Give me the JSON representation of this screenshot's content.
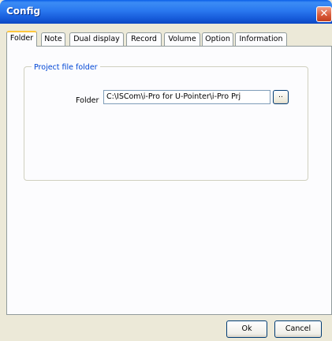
{
  "window": {
    "title": "Config",
    "close_glyph": "✕"
  },
  "tabs": [
    {
      "label": "Folder",
      "active": true
    },
    {
      "label": "Note"
    },
    {
      "label": "Dual display"
    },
    {
      "label": "Record"
    },
    {
      "label": "Volume"
    },
    {
      "label": "Option"
    },
    {
      "label": "Information"
    }
  ],
  "folder_tab": {
    "group_title": "Project file folder",
    "folder_label": "Folder",
    "folder_value": "C:\\ISCom\\i-Pro for U-Pointer\\i-Pro Prj",
    "browse_label": ".."
  },
  "buttons": {
    "ok": "Ok",
    "cancel": "Cancel"
  },
  "colors": {
    "titlebar": "#1559d8",
    "close": "#d95b3b",
    "active_tab_accent": "#ffc73c",
    "group_title": "#0046d5"
  }
}
